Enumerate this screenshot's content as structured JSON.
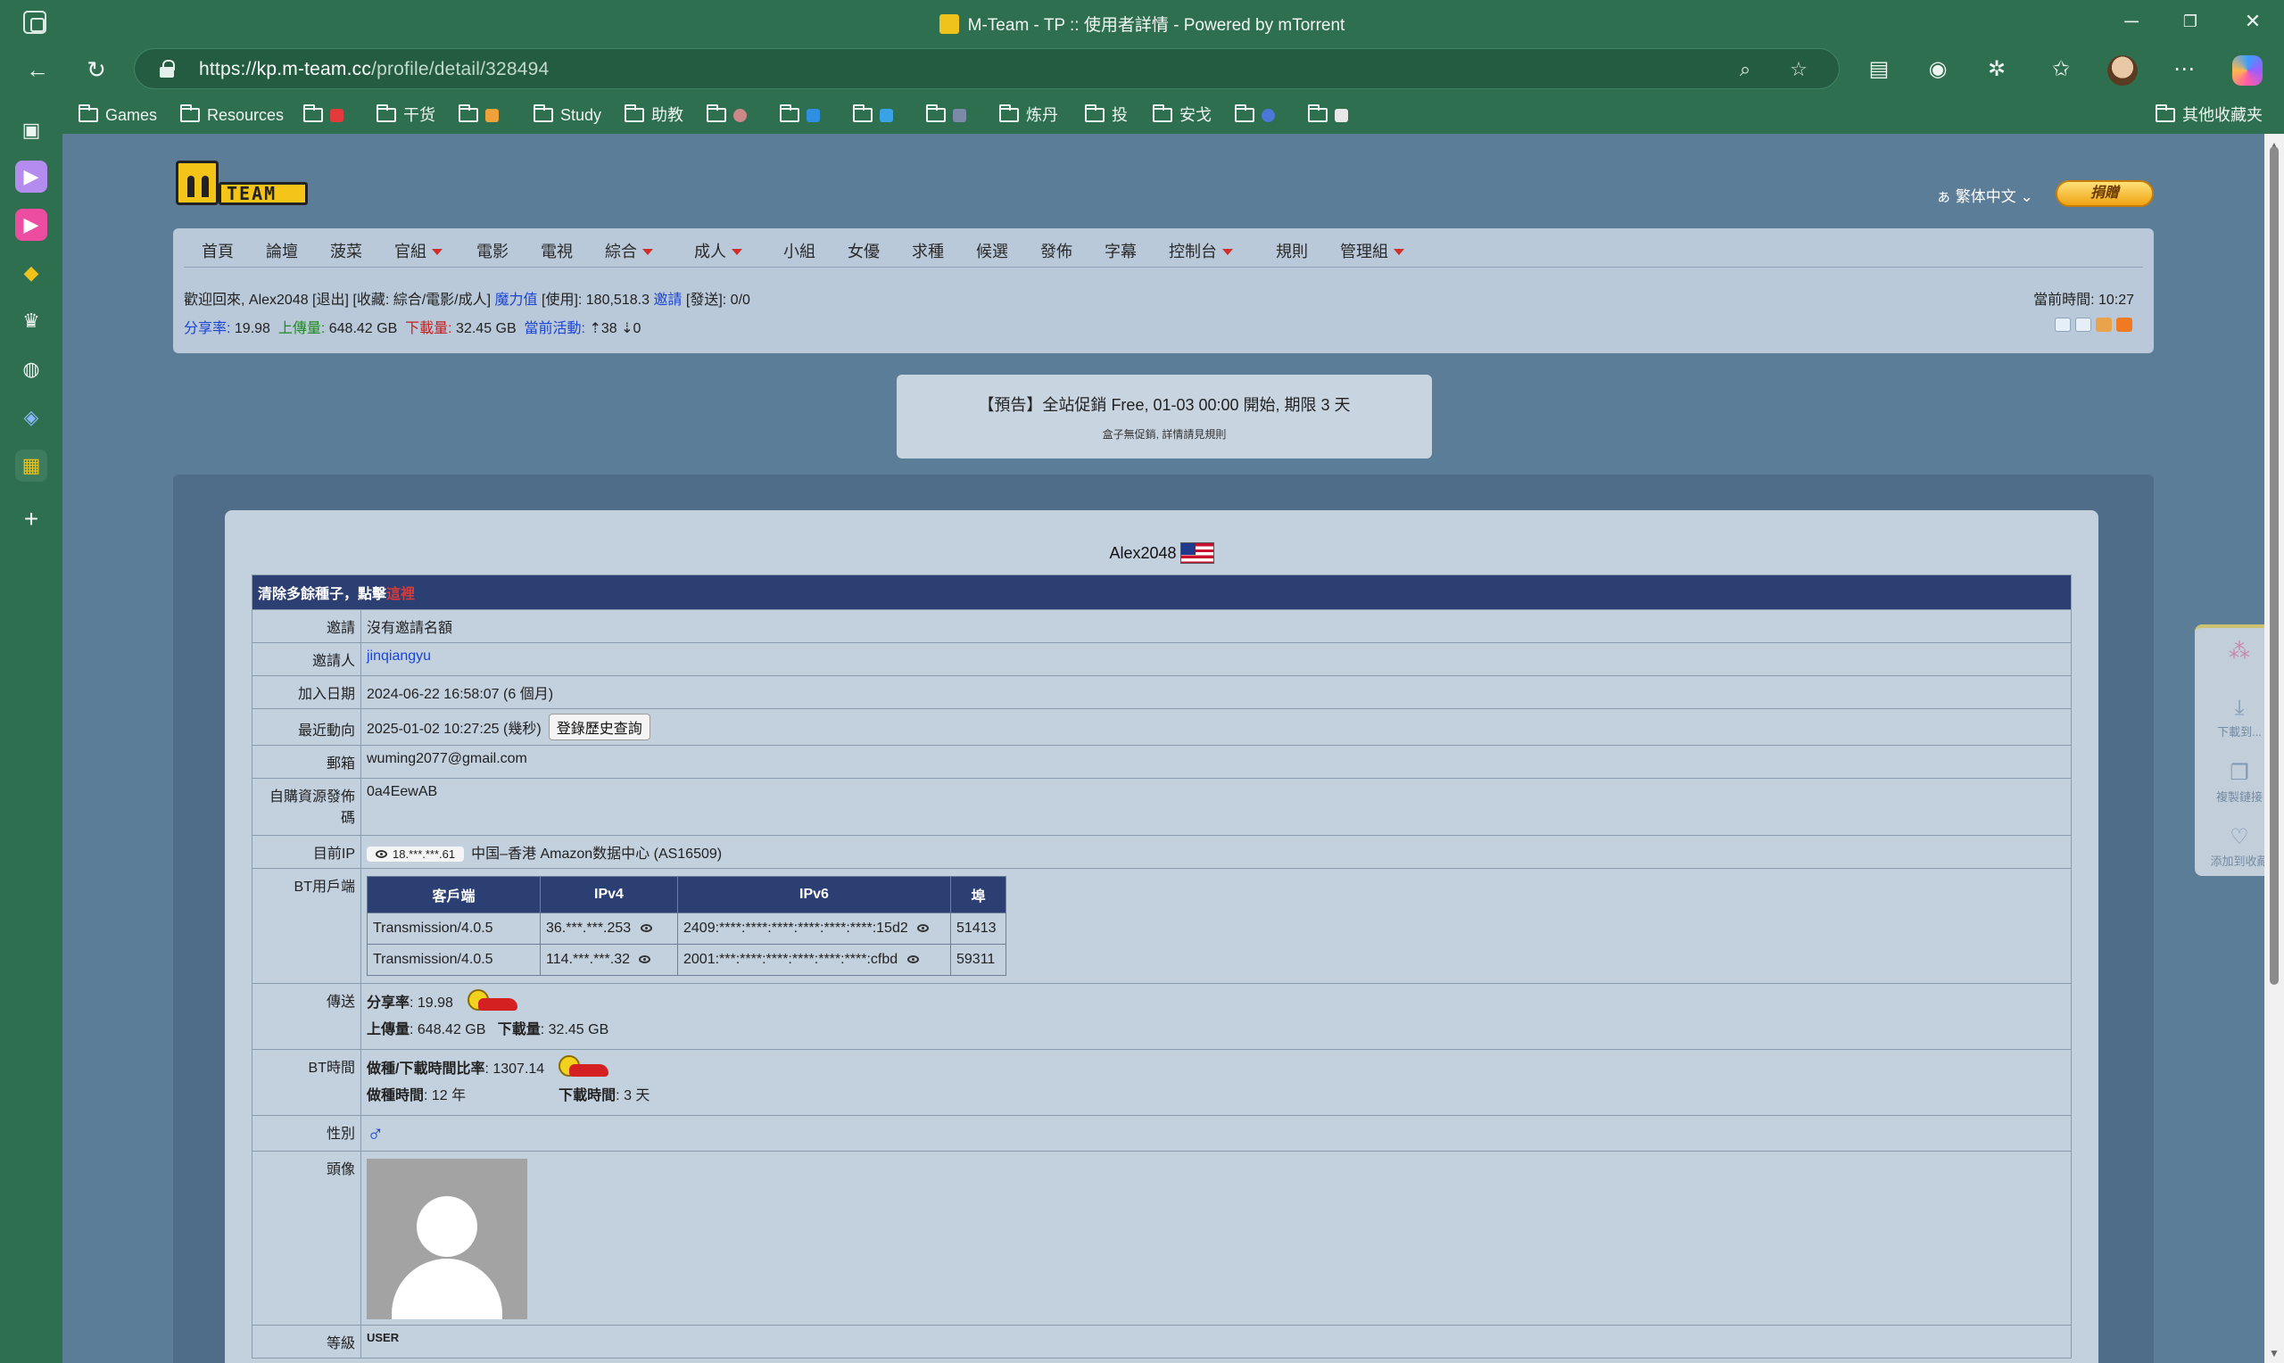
{
  "window": {
    "title": "M-Team - TP :: 使用者詳情 - Powered by mTorrent"
  },
  "address": {
    "host": "kp.m-team.cc",
    "path": "/profile/detail/328494",
    "scheme": "https://"
  },
  "bookmarks": [
    {
      "label": "Games"
    },
    {
      "label": "Resources"
    },
    {
      "label": ""
    },
    {
      "label": "干货"
    },
    {
      "label": ""
    },
    {
      "label": "Study"
    },
    {
      "label": "助教"
    },
    {
      "label": ""
    },
    {
      "label": ""
    },
    {
      "label": ""
    },
    {
      "label": ""
    },
    {
      "label": "炼丹"
    },
    {
      "label": "投"
    },
    {
      "label": "安戈"
    },
    {
      "label": ""
    },
    {
      "label": ""
    }
  ],
  "bookmarks_other": "其他收藏夹",
  "lang": {
    "label": "繁体中文"
  },
  "donate_label": "捐贈",
  "menu": [
    {
      "label": "首頁",
      "dropdown": false
    },
    {
      "label": "論壇",
      "dropdown": false
    },
    {
      "label": "菠菜",
      "dropdown": false
    },
    {
      "label": "官組",
      "dropdown": true
    },
    {
      "label": "電影",
      "dropdown": false
    },
    {
      "label": "電視",
      "dropdown": false
    },
    {
      "label": "綜合",
      "dropdown": true
    },
    {
      "label": "成人",
      "dropdown": true
    },
    {
      "label": "小組",
      "dropdown": false
    },
    {
      "label": "女優",
      "dropdown": false
    },
    {
      "label": "求種",
      "dropdown": false
    },
    {
      "label": "候選",
      "dropdown": false
    },
    {
      "label": "發佈",
      "dropdown": false
    },
    {
      "label": "字幕",
      "dropdown": false
    },
    {
      "label": "控制台",
      "dropdown": true
    },
    {
      "label": "規則",
      "dropdown": false
    },
    {
      "label": "管理組",
      "dropdown": true
    }
  ],
  "userbar": {
    "welcome": "歡迎回來, Alex2048 [退出] [收藏: 綜合/電影/成人]",
    "bonus_label": "魔力值",
    "bonus_value": "[使用]: 180,518.3",
    "invite_label": "邀請",
    "invite_value": "[發送]: 0/0",
    "ratio_label": "分享率:",
    "ratio_value": "19.98",
    "upload_label": "上傳量:",
    "upload_value": "648.42 GB",
    "download_label": "下載量:",
    "download_value": "32.45 GB",
    "activity_label": "當前活動:",
    "activity_value": "⇡38 ⇣0",
    "time": "當前時間: 10:27"
  },
  "notice": {
    "main": "【預告】全站促銷 Free, 01-03 00:00 開始, 期限 3 天",
    "sub": "盒子無促銷, 詳情請見規則"
  },
  "profile": {
    "username": "Alex2048",
    "clear_seed_text": "清除多餘種子，點擊",
    "clear_seed_link": "這裡",
    "rows": {
      "invite": {
        "label": "邀請",
        "value": "沒有邀請名額"
      },
      "inviter": {
        "label": "邀請人",
        "value": "jinqiangyu"
      },
      "joined": {
        "label": "加入日期",
        "value": "2024-06-22 16:58:07 (6 個月)"
      },
      "last_seen": {
        "label": "最近動向",
        "value": "2025-01-02 10:27:25 (幾秒)",
        "button": "登錄歷史查詢"
      },
      "email": {
        "label": "郵箱",
        "value": "wuming2077@gmail.com"
      },
      "code": {
        "label": "自購資源發佈碼",
        "value": "0a4EewAB"
      },
      "ip": {
        "label": "目前IP",
        "ip_masked": "18.***.***.61",
        "location": "中国–香港 Amazon数据中心 (AS16509)"
      },
      "bt_clients": {
        "label": "BT用戶端",
        "headers": [
          "客戶端",
          "IPv4",
          "IPv6",
          "埠"
        ],
        "rows": [
          [
            "Transmission/4.0.5",
            "36.***.***.253",
            "2409:****:****:****:****:****:****:15d2",
            "51413"
          ],
          [
            "Transmission/4.0.5",
            "114.***.***.32",
            "2001:***:****:****:****:****:****:cfbd",
            "59311"
          ]
        ]
      },
      "transfer": {
        "label": "傳送",
        "ratio_label": "分享率",
        "ratio_value": ": 19.98",
        "up_label": "上傳量",
        "up_value": ": 648.42 GB",
        "down_label": "下載量",
        "down_value": ": 32.45 GB"
      },
      "bt_time": {
        "label": "BT時間",
        "ratio_label": "做種/下載時間比率",
        "ratio_value": ": 1307.14",
        "seed_label": "做種時間",
        "seed_value": ": 12 年",
        "dl_label": "下載時間",
        "dl_value": ": 3 天"
      },
      "gender": {
        "label": "性別",
        "value": "♂"
      },
      "avatar": {
        "label": "頭像"
      },
      "class": {
        "label": "等級",
        "value": "USER"
      }
    }
  },
  "float_panel": [
    "下載到...",
    "複製鏈接",
    "添加到收藏"
  ],
  "colors": {
    "browser_green": "#2e6f4f",
    "page_bg": "#5c7d98",
    "table_head": "#2c3f73"
  }
}
